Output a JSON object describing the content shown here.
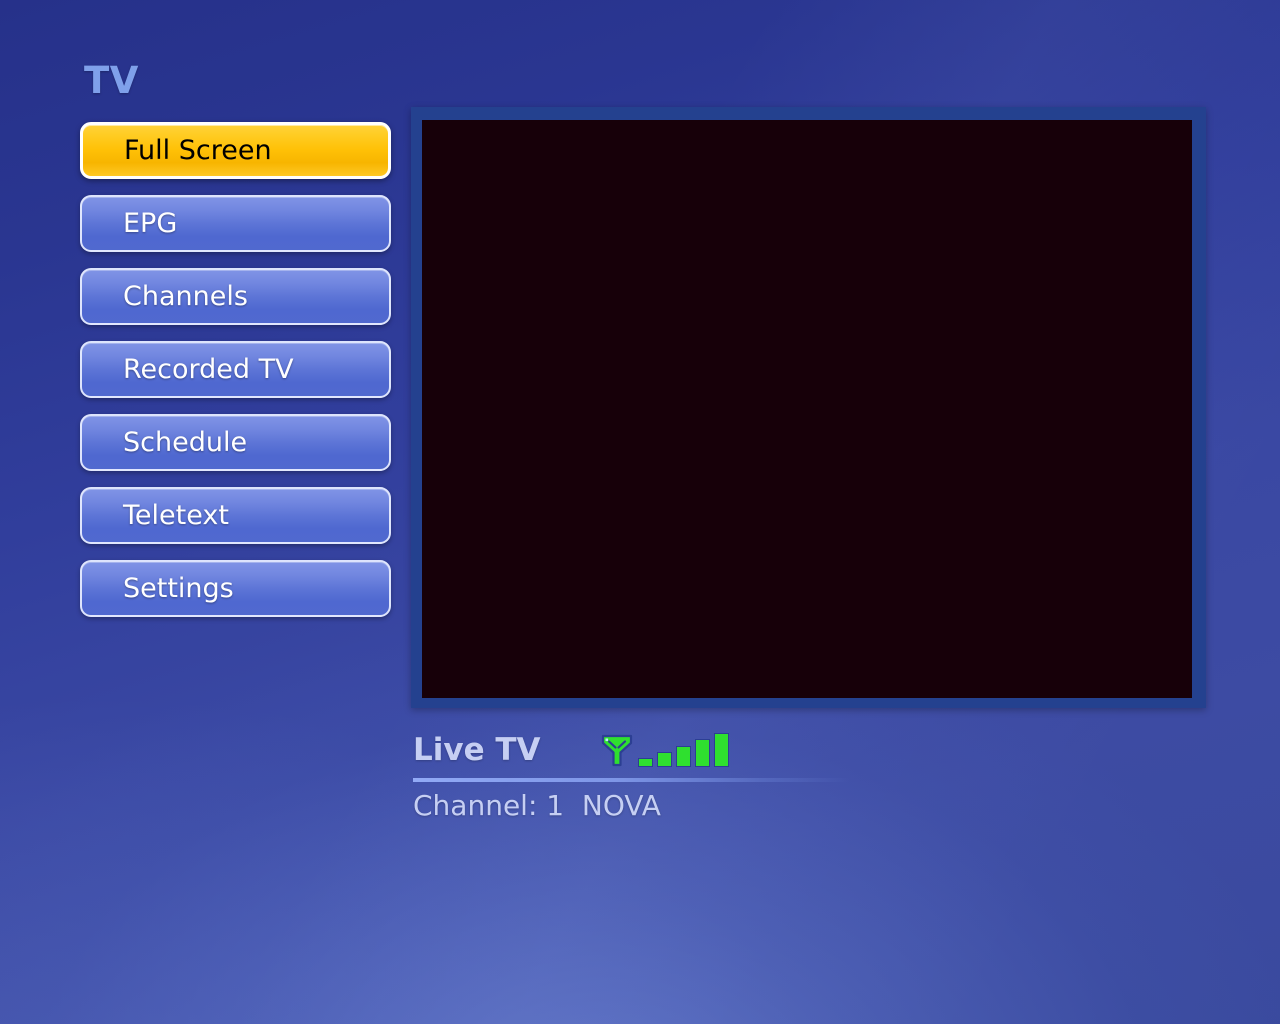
{
  "page": {
    "title": "TV"
  },
  "menu": {
    "items": [
      {
        "label": "Full Screen",
        "selected": true
      },
      {
        "label": "EPG",
        "selected": false
      },
      {
        "label": "Channels",
        "selected": false
      },
      {
        "label": "Recorded TV",
        "selected": false
      },
      {
        "label": "Schedule",
        "selected": false
      },
      {
        "label": "Teletext",
        "selected": false
      },
      {
        "label": "Settings",
        "selected": false
      }
    ]
  },
  "video": {
    "state": "blank"
  },
  "info": {
    "source_label": "Live TV",
    "channel_line": "Channel: 1  NOVA",
    "channel_number": "1",
    "channel_name": "NOVA",
    "signal": {
      "icon": "antenna-icon",
      "bars_total": 5,
      "bars_active": 5
    }
  },
  "colors": {
    "accent_selected": "#ffc107",
    "selected_text": "#000000",
    "menu_button": "#5c74d6",
    "menu_text": "#ffffff",
    "title_text": "#7fa0ea",
    "info_text": "#c6cff3",
    "signal_green": "#2fe02f",
    "video_frame": "#24418f",
    "video_surface": "#170009",
    "background_top": "#26318a",
    "background_bottom": "#3d4ba3"
  }
}
